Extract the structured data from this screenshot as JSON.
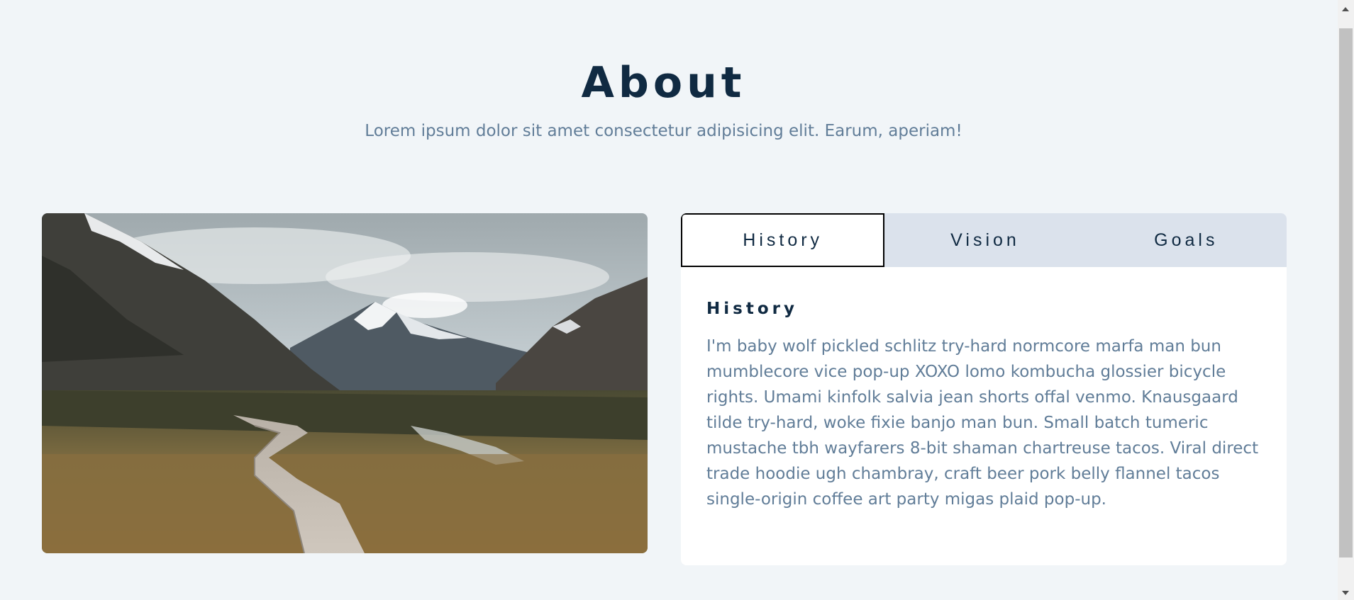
{
  "header": {
    "title": "About",
    "subtitle": "Lorem ipsum dolor sit amet consectetur adipisicing elit. Earum, aperiam!"
  },
  "image": {
    "description_icon": "landscape-photo"
  },
  "tabs": [
    {
      "label": "History",
      "active": true
    },
    {
      "label": "Vision",
      "active": false
    },
    {
      "label": "Goals",
      "active": false
    }
  ],
  "content": {
    "heading": "History",
    "body": "I'm baby wolf pickled schlitz try-hard normcore marfa man bun mumblecore vice pop-up XOXO lomo kombucha glossier bicycle rights. Umami kinfolk salvia jean shorts offal venmo. Knausgaard tilde try-hard, woke fixie banjo man bun. Small batch tumeric mustache tbh wayfarers 8-bit shaman chartreuse tacos. Viral direct trade hoodie ugh chambray, craft beer pork belly flannel tacos single-origin coffee art party migas plaid pop-up."
  },
  "colors": {
    "background": "#f1f5f8",
    "heading": "#102a42",
    "text": "#617d98",
    "tab_bar": "#dbe2ec"
  }
}
